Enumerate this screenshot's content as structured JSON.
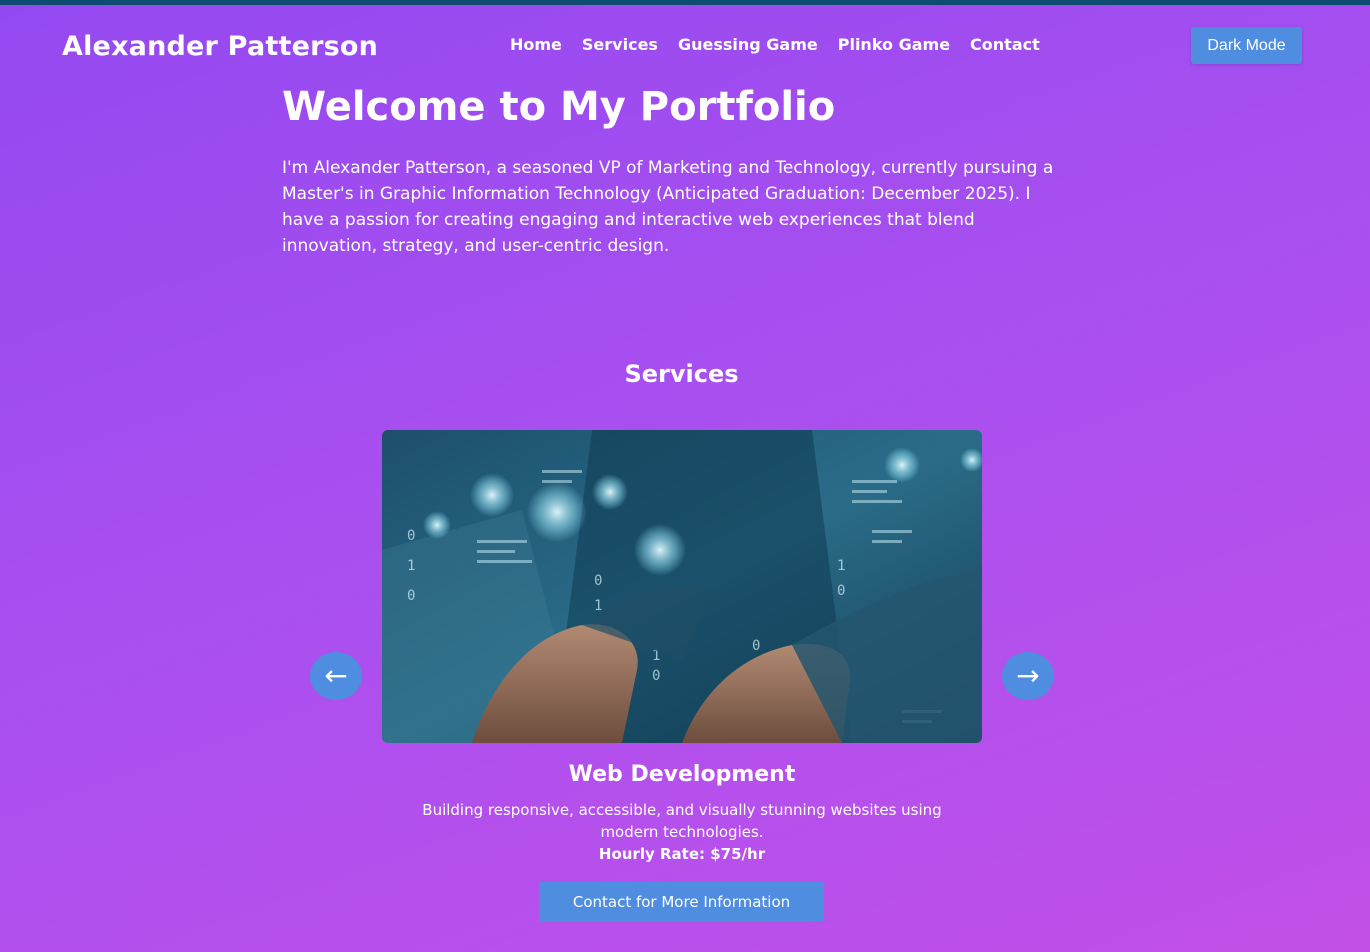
{
  "header": {
    "brand": "Alexander Patterson",
    "nav": [
      "Home",
      "Services",
      "Guessing Game",
      "Plinko Game",
      "Contact"
    ],
    "theme_toggle_label": "Dark Mode"
  },
  "hero": {
    "title": "Welcome to My Portfolio",
    "text": "I'm Alexander Patterson, a seasoned VP of Marketing and Technology, currently pursuing a Master's in Graphic Information Technology (Anticipated Graduation: December 2025). I have a passion for creating engaging and interactive web experiences that blend innovation, strategy, and user-centric design."
  },
  "services": {
    "heading": "Services",
    "prev_icon": "←",
    "next_icon": "→",
    "current_slide": {
      "title": "Web Development",
      "description": "Building responsive, accessible, and visually stunning websites using modern technologies.",
      "rate": "Hourly Rate: $75/hr",
      "cta_label": "Contact for More Information"
    }
  },
  "colors": {
    "gradient_start": "#9449f0",
    "gradient_end": "#c250e8",
    "button": "#4f8de0",
    "top_strip": "#0e4c72",
    "text": "#ffffff"
  }
}
